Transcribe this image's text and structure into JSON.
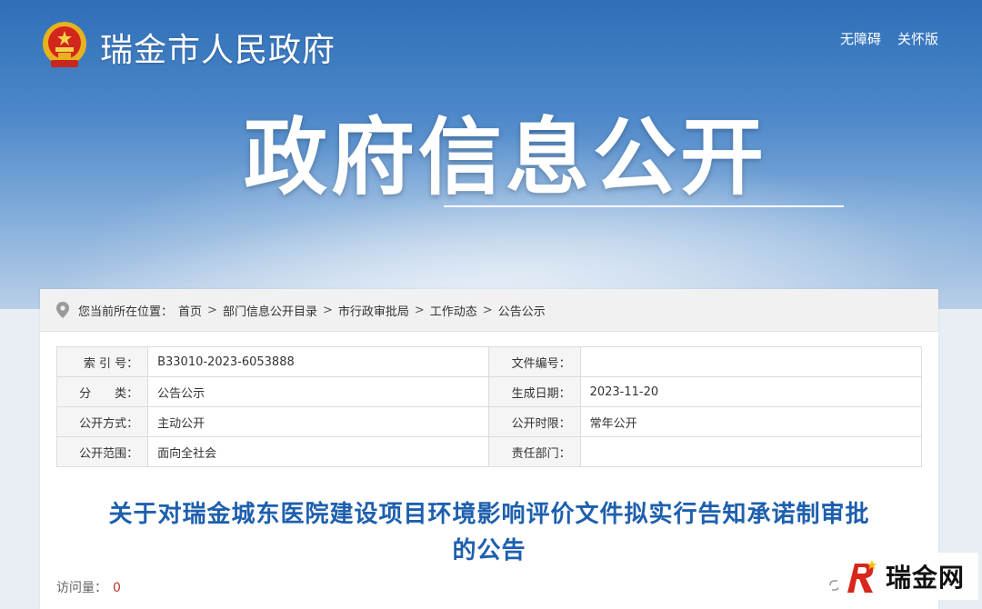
{
  "header": {
    "site_title": "瑞金市人民政府",
    "links": [
      "无障碍",
      "关怀版"
    ],
    "hero_title": "政府信息公开"
  },
  "breadcrumb": {
    "prefix": "您当前所在位置：",
    "items": [
      "首页",
      "部门信息公开目录",
      "市行政审批局",
      "工作动态",
      "公告公示"
    ],
    "separator": ">"
  },
  "meta_table": {
    "rows": [
      {
        "label1": "索 引 号：",
        "value1": "B33010-2023-6053888",
        "label2": "文件编号：",
        "value2": ""
      },
      {
        "label1": "分　　类：",
        "value1": "公告公示",
        "label2": "生成日期：",
        "value2": "2023-11-20"
      },
      {
        "label1": "公开方式：",
        "value1": "主动公开",
        "label2": "公开时限：",
        "value2": "常年公开"
      },
      {
        "label1": "公开范围：",
        "value1": "面向全社会",
        "label2": "责任部门：",
        "value2": ""
      }
    ]
  },
  "document": {
    "title_line1": "关于对瑞金城东医院建设项目环境影响评价文件拟实行告知承诺制审批",
    "title_line2": "的公告",
    "visits_label": "访问量：",
    "visits_count": "0"
  },
  "watermark": {
    "text": "瑞金网"
  },
  "colors": {
    "title_blue": "#1e5fae",
    "banner_blue": "#2f6fb8",
    "count_red": "#c0392b"
  }
}
